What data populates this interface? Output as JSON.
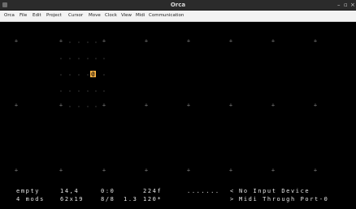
{
  "window": {
    "title": "Orca",
    "controls": {
      "minimize": "–",
      "maximize": "▫",
      "close": "×"
    }
  },
  "menu": [
    "Orca",
    "File",
    "Edit",
    "Project",
    "Cursor",
    "Move",
    "Clock",
    "View",
    "Midi",
    "Communication"
  ],
  "grid": {
    "marker_glyph": "+",
    "dot_glyph": ".",
    "cursor_glyph": "@"
  },
  "status": {
    "line1": {
      "name": "empty",
      "position": "14,4",
      "selection": "0:0",
      "frame": "224f",
      "activity": ".......",
      "io_arrow": "<",
      "input_device": "No Input Device"
    },
    "line2": {
      "mods": "4 mods",
      "size": "62x19",
      "grid_scale": "8/8",
      "speed": "1.3",
      "bpm": "120*",
      "io_arrow": ">",
      "output_device": "Midi Through Port-0"
    }
  },
  "colors": {
    "background": "#000000",
    "grid": "#7a7a7a",
    "cursor": "#ffb545",
    "text": "#e6e6e6"
  }
}
